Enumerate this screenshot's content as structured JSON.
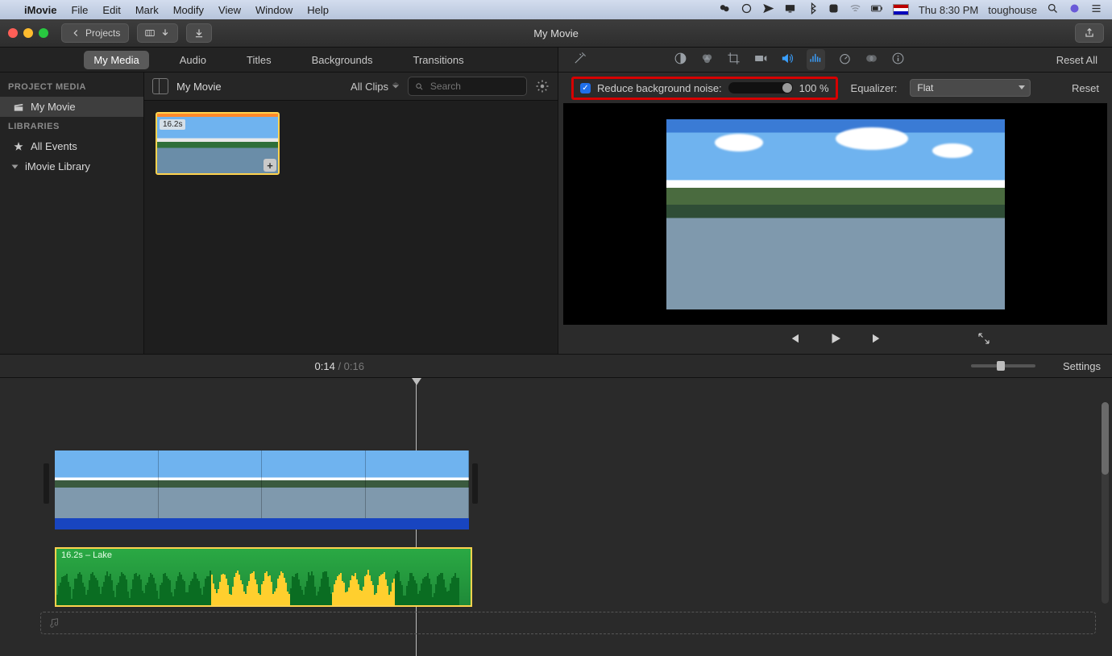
{
  "menubar": {
    "app": "iMovie",
    "items": [
      "File",
      "Edit",
      "Mark",
      "Modify",
      "View",
      "Window",
      "Help"
    ],
    "status_time": "Thu 8:30 PM",
    "user": "toughouse"
  },
  "toolbar": {
    "projects": "Projects",
    "title": "My Movie"
  },
  "left_tabs": [
    "My Media",
    "Audio",
    "Titles",
    "Backgrounds",
    "Transitions"
  ],
  "sidebar": {
    "project_media_header": "PROJECT MEDIA",
    "project_item": "My Movie",
    "libraries_header": "LIBRARIES",
    "all_events": "All Events",
    "imovie_library": "iMovie Library"
  },
  "browser": {
    "crumb": "My Movie",
    "filter": "All Clips",
    "search_placeholder": "Search",
    "clip_duration": "16.2s"
  },
  "inspector": {
    "reset_all": "Reset All",
    "noise_label": "Reduce background noise:",
    "noise_value": "100 %",
    "equalizer_label": "Equalizer:",
    "equalizer_value": "Flat",
    "reset": "Reset"
  },
  "timeline": {
    "current": "0:14",
    "total": "0:16",
    "settings": "Settings",
    "audio_clip_label": "16.2s – Lake"
  }
}
